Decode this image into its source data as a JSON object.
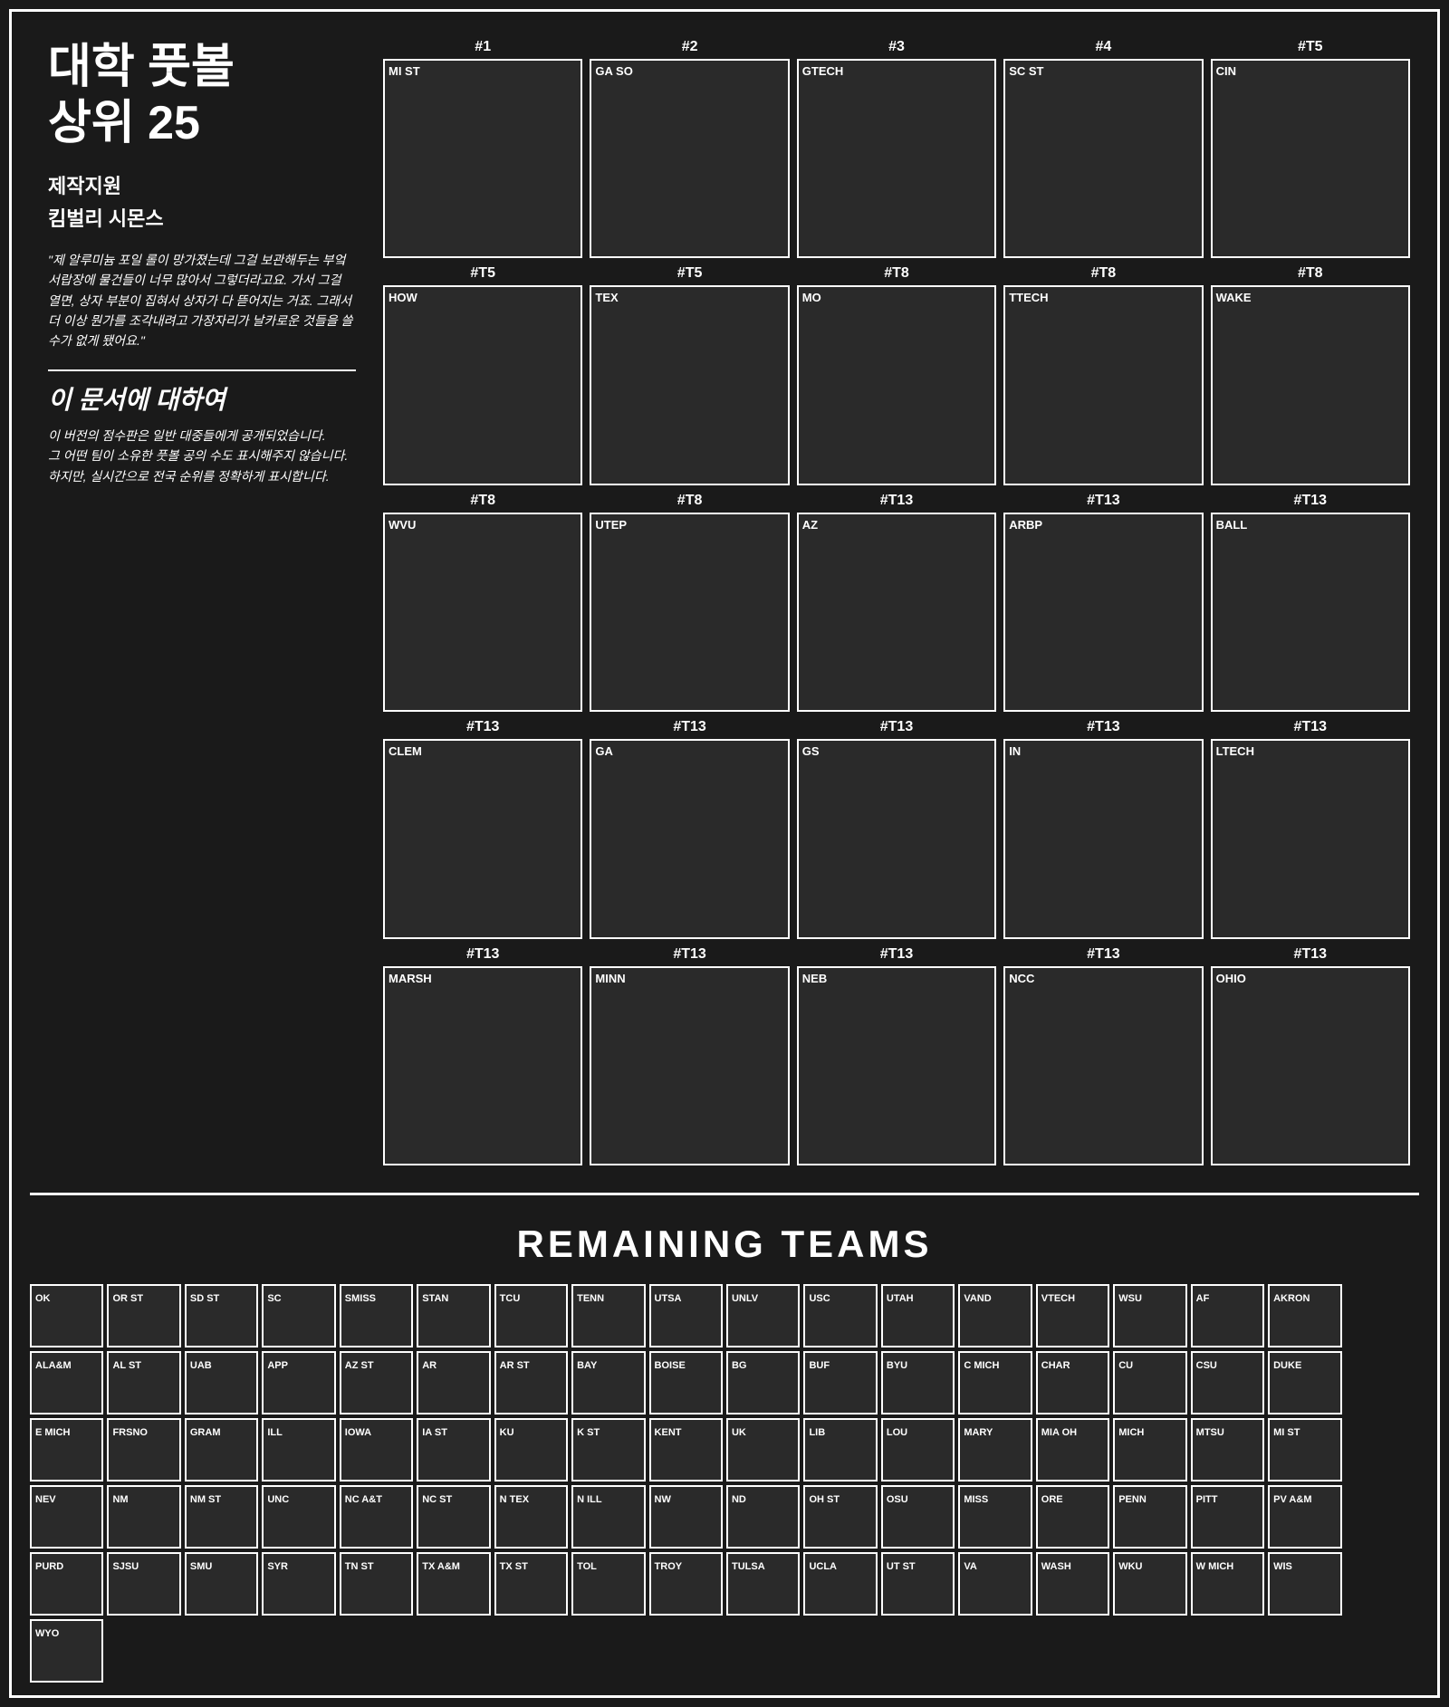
{
  "title": "대학 풋볼\n상위 25",
  "sponsor_label": "제작지원",
  "sponsor_name": "킴벌리 시몬스",
  "quote": "\"제 알루미늄 포일 롤이 망가졌는데 그걸 보관해두는 부엌 서랍장에 물건들이 너무 많아서 그렇더라고요. 가서 그걸 열면, 상자 부분이 집혀서 상자가 다 뜯어지는 거죠. 그래서 더 이상 뭔가를 조각내려고 가장자리가 날카로운 것들을 쓸 수가 없게 됐어요.\"",
  "about_title": "이 문서에 대하여",
  "about_text": "이 버전의 점수판은 일반 대중들에게 공개되었습니다.\n그 어떤 팀이 소유한 풋볼 공의 수도 표시해주지 않습니다.\n하지만, 실시간으로 전국 순위를 정확하게 표시합니다.",
  "remaining_title": "REMAINING TEAMS",
  "rankings": [
    {
      "rank": "#1",
      "abbr": "MI ST"
    },
    {
      "rank": "#2",
      "abbr": "GA SO"
    },
    {
      "rank": "#3",
      "abbr": "GTECH"
    },
    {
      "rank": "#4",
      "abbr": "SC ST"
    },
    {
      "rank": "#T5",
      "abbr": "CIN"
    },
    {
      "rank": "#T5",
      "abbr": "HOW"
    },
    {
      "rank": "#T5",
      "abbr": "TEX"
    },
    {
      "rank": "#T8",
      "abbr": "MO"
    },
    {
      "rank": "#T8",
      "abbr": "TTECH"
    },
    {
      "rank": "#T8",
      "abbr": "WAKE"
    },
    {
      "rank": "#T8",
      "abbr": "WVU"
    },
    {
      "rank": "#T8",
      "abbr": "UTEP"
    },
    {
      "rank": "#T13",
      "abbr": "AZ"
    },
    {
      "rank": "#T13",
      "abbr": "ARBP"
    },
    {
      "rank": "#T13",
      "abbr": "BALL"
    },
    {
      "rank": "#T13",
      "abbr": "CLEM"
    },
    {
      "rank": "#T13",
      "abbr": "GA"
    },
    {
      "rank": "#T13",
      "abbr": "GS"
    },
    {
      "rank": "#T13",
      "abbr": "IN"
    },
    {
      "rank": "#T13",
      "abbr": "LTECH"
    },
    {
      "rank": "#T13",
      "abbr": "MARSH"
    },
    {
      "rank": "#T13",
      "abbr": "MINN"
    },
    {
      "rank": "#T13",
      "abbr": "NEB"
    },
    {
      "rank": "#T13",
      "abbr": "NCC"
    },
    {
      "rank": "#T13",
      "abbr": "OHIO"
    }
  ],
  "remaining_rows": [
    [
      "OK",
      "OR ST",
      "SD ST",
      "SC",
      "SMISS",
      "STAN",
      "TCU",
      "TENN",
      "UTSA",
      "UNLV",
      "USC",
      "UTAH",
      "VAND",
      "VTECH",
      "WSU",
      "AF",
      "AKRON",
      ""
    ],
    [
      "ALA&M",
      "AL ST",
      "UAB",
      "APP",
      "AZ ST",
      "AR",
      "AR ST",
      "BAY",
      "BOISE",
      "BG",
      "BUF",
      "BYU",
      "C MICH",
      "CHAR",
      "CU",
      "CSU",
      "DUKE",
      ""
    ],
    [
      "E MICH",
      "FRSNO",
      "GRAM",
      "ILL",
      "IOWA",
      "IA ST",
      "KU",
      "K ST",
      "KENT",
      "UK",
      "LIB",
      "LOU",
      "MARY",
      "MIA OH",
      "MICH",
      "MTSU",
      "MI ST",
      ""
    ],
    [
      "NEV",
      "NM",
      "NM ST",
      "UNC",
      "NC A&T",
      "NC ST",
      "N TEX",
      "N ILL",
      "NW",
      "ND",
      "OH ST",
      "OSU",
      "MISS",
      "ORE",
      "PENN",
      "PITT",
      "PV A&M",
      ""
    ],
    [
      "PURD",
      "SJSU",
      "SMU",
      "SYR",
      "TN ST",
      "TX A&M",
      "TX ST",
      "TOL",
      "TROY",
      "TULSA",
      "UCLA",
      "UT ST",
      "VA",
      "WASH",
      "WKU",
      "W MICH",
      "WIS",
      ""
    ],
    [
      "WYO",
      "",
      "",
      "",
      "",
      "",
      "",
      "",
      "",
      "",
      "",
      "",
      "",
      "",
      "",
      "",
      "",
      ""
    ]
  ]
}
